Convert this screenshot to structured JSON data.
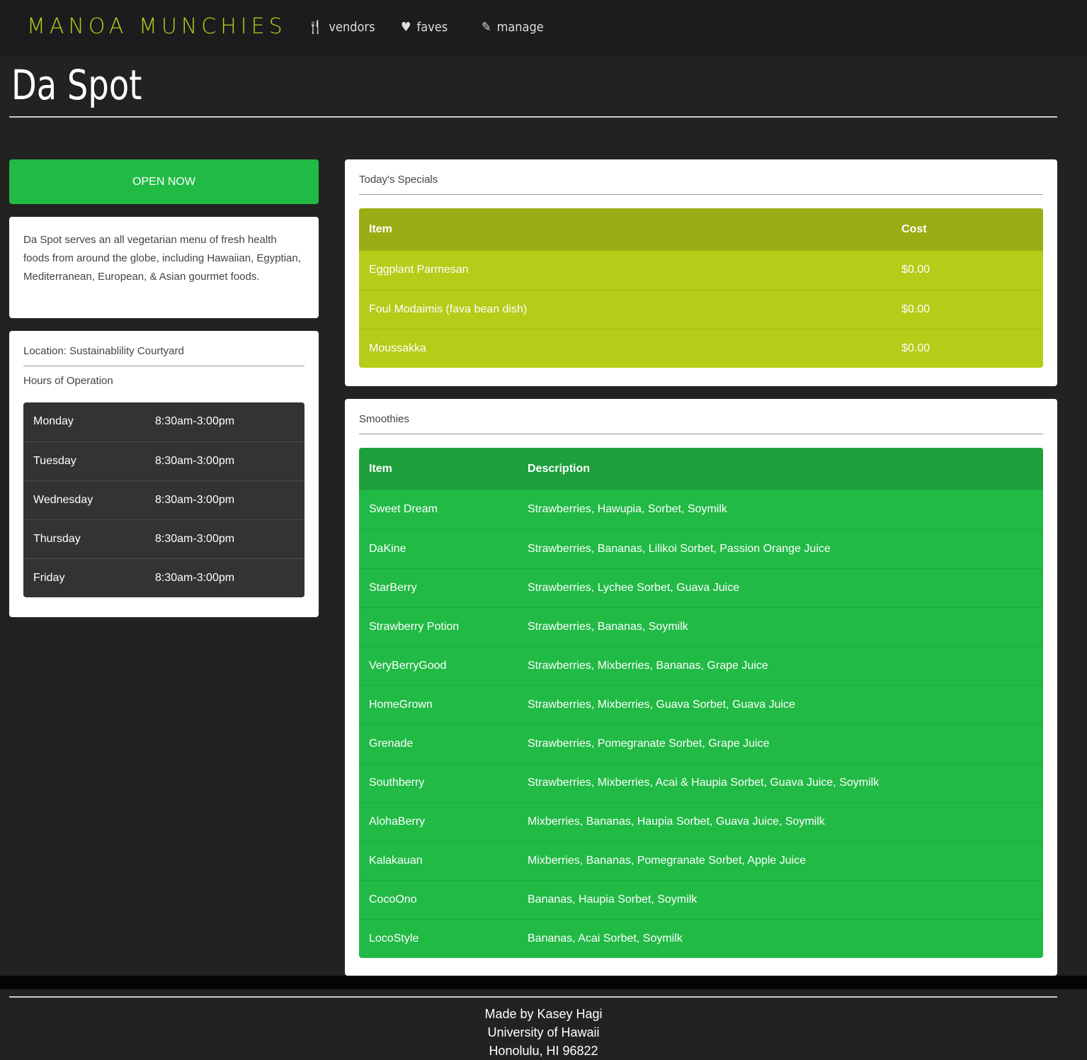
{
  "nav": {
    "brand": "MANOA MUNCHIES",
    "items": [
      {
        "label": "vendors",
        "icon": "utensils-icon"
      },
      {
        "label": "faves",
        "icon": "heart-icon"
      },
      {
        "label": "manage",
        "icon": "edit-icon"
      }
    ]
  },
  "page": {
    "title": "Da Spot"
  },
  "status": {
    "label": "OPEN NOW",
    "color": "#21ba45"
  },
  "description": "Da Spot serves an all vegetarian menu of fresh health foods from around the globe, including Hawaiian, Egyptian, Mediterranean, European, & Asian gourmet foods.",
  "location": {
    "label": "Location: Sustainablility Courtyard",
    "hours_label": "Hours of Operation",
    "hours": [
      {
        "day": "Monday",
        "time": "8:30am-3:00pm"
      },
      {
        "day": "Tuesday",
        "time": "8:30am-3:00pm"
      },
      {
        "day": "Wednesday",
        "time": "8:30am-3:00pm"
      },
      {
        "day": "Thursday",
        "time": "8:30am-3:00pm"
      },
      {
        "day": "Friday",
        "time": "8:30am-3:00pm"
      }
    ]
  },
  "specials": {
    "title": "Today's Specials",
    "headers": [
      "Item",
      "Cost"
    ],
    "rows": [
      [
        "Eggplant Parmesan",
        "$0.00"
      ],
      [
        "Foul Modaimis (fava bean dish)",
        "$0.00"
      ],
      [
        "Moussakka",
        "$0.00"
      ]
    ]
  },
  "smoothies": {
    "title": "Smoothies",
    "headers": [
      "Item",
      "Description"
    ],
    "rows": [
      [
        "Sweet Dream",
        "Strawberries, Hawupia, Sorbet, Soymilk"
      ],
      [
        "DaKine",
        "Strawberries, Bananas, Lilikoi Sorbet, Passion Orange Juice"
      ],
      [
        "StarBerry",
        "Strawberries, Lychee Sorbet, Guava Juice"
      ],
      [
        "Strawberry Potion",
        "Strawberries, Bananas, Soymilk"
      ],
      [
        "VeryBerryGood",
        "Strawberries, Mixberries, Bananas, Grape Juice"
      ],
      [
        "HomeGrown",
        "Strawberries, Mixberries, Guava Sorbet, Guava Juice"
      ],
      [
        "Grenade",
        "Strawberries, Pomegranate Sorbet, Grape Juice"
      ],
      [
        "Southberry",
        "Strawberries, Mixberries, Acai & Haupia Sorbet, Guava Juice, Soymilk"
      ],
      [
        "AlohaBerry",
        "Mixberries, Bananas, Haupia Sorbet, Guava Juice, Soymilk"
      ],
      [
        "Kalakauan",
        "Mixberries, Bananas, Pomegranate Sorbet, Apple Juice"
      ],
      [
        "CocoOno",
        "Bananas, Haupia Sorbet, Soymilk"
      ],
      [
        "LocoStyle",
        "Bananas, Acai Sorbet, Soymilk"
      ]
    ]
  },
  "footer": {
    "lines": [
      "Made by Kasey Hagi",
      "University of Hawaii",
      "Honolulu, HI 96822"
    ]
  }
}
